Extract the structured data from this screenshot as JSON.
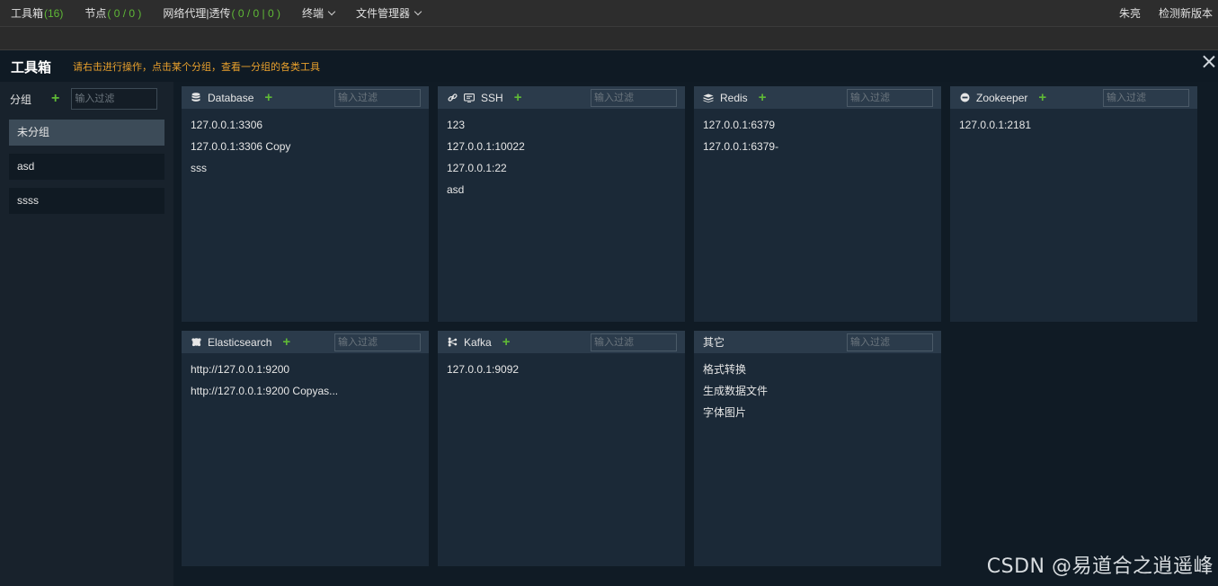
{
  "nav": {
    "items": [
      {
        "label": "工具箱",
        "count": "(16)"
      },
      {
        "label": "节点",
        "count": "( 0 / 0 )"
      },
      {
        "label": "网络代理|透传",
        "count": "( 0 / 0 | 0 )"
      },
      {
        "label": "终端"
      },
      {
        "label": "文件管理器"
      }
    ],
    "right": [
      "朱亮",
      "检测新版本"
    ]
  },
  "toolbox": {
    "title": "工具箱",
    "hint": "请右击进行操作，点击某个分组，查看一分组的各类工具"
  },
  "groups": {
    "label": "分组",
    "filter_placeholder": "输入过滤",
    "items": [
      "未分组",
      "asd",
      "ssss"
    ]
  },
  "filter_placeholder": "输入过滤",
  "cards": [
    {
      "title": "Database",
      "icon": "database-icon",
      "items": [
        "127.0.0.1:3306",
        "127.0.0.1:3306 Copy",
        "sss"
      ]
    },
    {
      "title": "SSH",
      "icon": "link-terminal-icon",
      "items": [
        "123",
        "127.0.0.1:10022",
        "127.0.0.1:22",
        "asd"
      ]
    },
    {
      "title": "Redis",
      "icon": "redis-icon",
      "items": [
        "127.0.0.1:6379",
        "127.0.0.1:6379-"
      ]
    },
    {
      "title": "Zookeeper",
      "icon": "zookeeper-icon",
      "items": [
        "127.0.0.1:2181"
      ]
    },
    {
      "title": "Elasticsearch",
      "icon": "elasticsearch-icon",
      "items": [
        "http://127.0.0.1:9200",
        "http://127.0.0.1:9200 Copyas..."
      ]
    },
    {
      "title": "Kafka",
      "icon": "kafka-icon",
      "items": [
        "127.0.0.1:9092"
      ]
    },
    {
      "title": "其它",
      "icon": "",
      "items": [
        "格式转换",
        "生成数据文件",
        "字体图片"
      ]
    }
  ],
  "watermark": "CSDN @易道合之逍遥峰"
}
